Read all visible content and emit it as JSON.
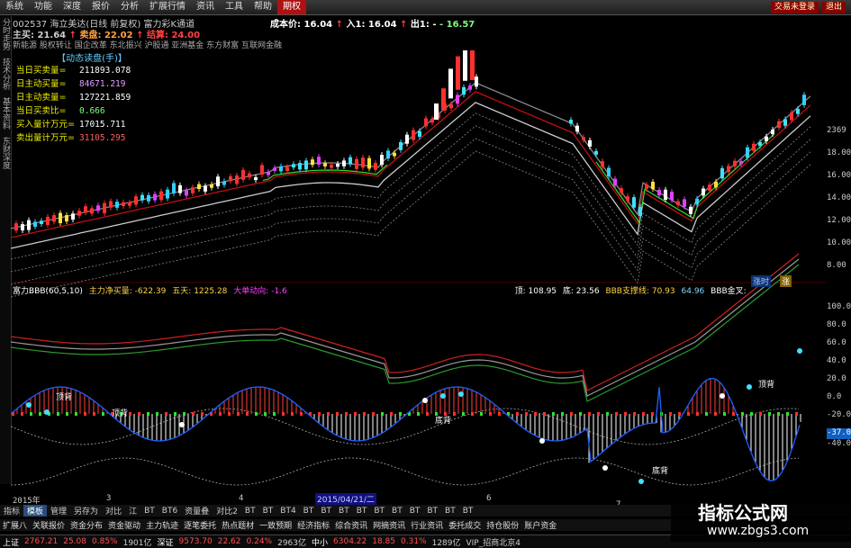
{
  "menu": {
    "items": [
      "系统",
      "功能",
      "深度",
      "报价",
      "分析",
      "扩展行情",
      "资讯",
      "工具",
      "帮助",
      "期权"
    ],
    "active_index": 9,
    "right": [
      "交易未登录",
      "退出"
    ]
  },
  "sidebar": {
    "tabs": [
      "分时走势",
      "技术分析",
      "基本资料",
      "东财深度"
    ]
  },
  "title": {
    "line1": "002537 海立美达(日线 前复权) 富力彩K通道",
    "cost": "成本价: 16.04",
    "in": "入1: 16.04",
    "out": "出1: -",
    "pos": "- 16.57"
  },
  "levels": {
    "zhu": "主买: 21.64",
    "sell": "卖盘: 22.02",
    "jie": "结算: 24.00"
  },
  "concepts": "新能源 股权转让 国企改革 东北振兴 沪股通 亚洲基金 东方财富 互联网金融",
  "panel": {
    "header": "【动态读盘(手)】",
    "rows": [
      {
        "k": "当日买卖量=",
        "v": "211893.078",
        "c": "#fff"
      },
      {
        "k": "日主动买量=",
        "v": "84671.219",
        "c": "#e0a0ff"
      },
      {
        "k": "日主动卖量=",
        "v": "127221.859",
        "c": "#fff"
      },
      {
        "k": "当日买卖比=",
        "v": "0.666",
        "c": "#7dff7d"
      },
      {
        "k": "买入量计万元=",
        "v": "17015.711",
        "c": "#fff"
      },
      {
        "k": "卖出量计万元=",
        "v": "31105.295",
        "c": "#ff6060"
      }
    ]
  },
  "price_axis": [
    "2369",
    "18.00",
    "16.00",
    "14.00",
    "12.00",
    "10.00",
    "8.00"
  ],
  "ind_axis": [
    "100.0",
    "80.0",
    "60.0",
    "40.0",
    "20.0",
    "0.0",
    "-20.0",
    "-37.03",
    "-40.0"
  ],
  "midbar": {
    "name": "富力BBB(60,5,10)",
    "main_net": "主力净买量: -622.39",
    "five": "五天: 1225.28",
    "big": "大单动向: -1.6",
    "line_h": "顶: 108.95",
    "line_l": "底: 23.56",
    "zt": "BBB支撑线: 70.93",
    "tag1": "涨时",
    "tag2": "涨",
    "val": "64.96",
    "end": "BBB金叉:"
  },
  "labels": {
    "top_div": "顶背",
    "top_div2": "顶背",
    "top_div3": "顶背",
    "bot_div": "底背",
    "bot_div2": "底背"
  },
  "dates": {
    "y2015": "2015年",
    "m3": "3",
    "m4": "4",
    "date": "2015/04/21/二",
    "m6": "6",
    "m7": "7"
  },
  "tabs1": [
    "指标",
    "模板",
    "管理",
    "另存为",
    "对比",
    "江",
    "BT",
    "BT6",
    "资量叠",
    "对比2",
    "BT",
    "BT",
    "BT4",
    "BT",
    "BT",
    "BT",
    "BT",
    "BT",
    "BT",
    "BT",
    "BT",
    "BT",
    "BT"
  ],
  "tabs1_on": 1,
  "tabs2": [
    "扩展八",
    "关联报价",
    "资金分布",
    "资金驱动",
    "主力轨迹",
    "逐笔委托",
    "热点题材",
    "一致预期",
    "经济指标",
    "综合资讯",
    "网摘资讯",
    "行业资讯",
    "委托成交",
    "持仓股份",
    "账户资金"
  ],
  "status": [
    {
      "t": "上证",
      "c": "#fff"
    },
    {
      "t": "2767.21",
      "c": "#ff5050"
    },
    {
      "t": "25.08",
      "c": "#ff5050"
    },
    {
      "t": "0.85%",
      "c": "#ff5050"
    },
    {
      "t": "1901亿",
      "c": "#ccc"
    },
    {
      "t": "深证",
      "c": "#fff"
    },
    {
      "t": "9573.70",
      "c": "#ff5050"
    },
    {
      "t": "22.62",
      "c": "#ff5050"
    },
    {
      "t": "0.24%",
      "c": "#ff5050"
    },
    {
      "t": "2963亿",
      "c": "#ccc"
    },
    {
      "t": "中小",
      "c": "#fff"
    },
    {
      "t": "6304.22",
      "c": "#ff5050"
    },
    {
      "t": "18.85",
      "c": "#ff5050"
    },
    {
      "t": "0.31%",
      "c": "#ff5050"
    },
    {
      "t": "1289亿",
      "c": "#ccc"
    },
    {
      "t": "VIP_招商北京4",
      "c": "#ccc"
    }
  ],
  "watermark": {
    "title": "指标公式网",
    "url": "www.zbgs3.com"
  }
}
